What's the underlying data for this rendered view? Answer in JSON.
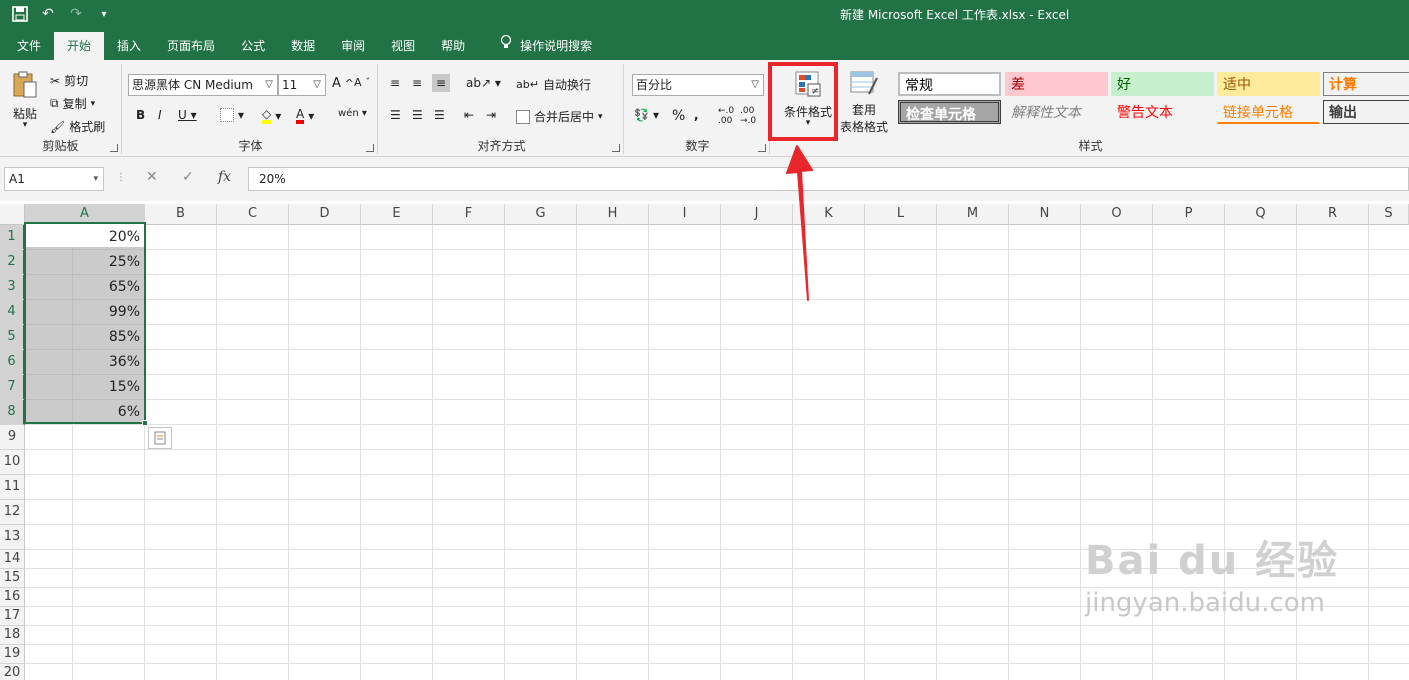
{
  "titlebar": {
    "title": "新建 Microsoft Excel 工作表.xlsx  -  Excel"
  },
  "tabs": [
    "文件",
    "开始",
    "插入",
    "页面布局",
    "公式",
    "数据",
    "审阅",
    "视图",
    "帮助"
  ],
  "tell_me": "操作说明搜索",
  "clipboard": {
    "paste": "粘贴",
    "cut": "剪切",
    "copy": "复制",
    "format_painter": "格式刷",
    "label": "剪贴板"
  },
  "font": {
    "name": "思源黑体 CN Medium",
    "size": "11",
    "label": "字体"
  },
  "alignment": {
    "wrap": "自动换行",
    "merge": "合并后居中",
    "label": "对齐方式"
  },
  "number": {
    "format": "百分比",
    "label": "数字"
  },
  "styles": {
    "conditional": "条件格式",
    "table_line1": "套用",
    "table_line2": "表格格式",
    "label": "样式",
    "cells": [
      {
        "text": "常规",
        "bg": "#ffffff",
        "color": "#000000"
      },
      {
        "text": "差",
        "bg": "#ffc7ce",
        "color": "#9c0006"
      },
      {
        "text": "好",
        "bg": "#c6efce",
        "color": "#006100"
      },
      {
        "text": "适中",
        "bg": "#ffeb9c",
        "color": "#9c5700"
      },
      {
        "text": "计算",
        "bg": "#f2f2f2",
        "color": "#fa7d00"
      },
      {
        "text": "检查单元格",
        "bg": "#a5a5a5",
        "color": "#ffffff"
      },
      {
        "text": "解释性文本",
        "bg": "transparent",
        "color": "#7f7f7f"
      },
      {
        "text": "警告文本",
        "bg": "transparent",
        "color": "#ff0000"
      },
      {
        "text": "链接单元格",
        "bg": "transparent",
        "color": "#fa7d00"
      },
      {
        "text": "输出",
        "bg": "#f2f2f2",
        "color": "#3f3f3f"
      }
    ]
  },
  "formula_bar": {
    "name_box": "A1",
    "value": "20%"
  },
  "columns": [
    "A",
    "B",
    "C",
    "D",
    "E",
    "F",
    "G",
    "H",
    "I",
    "J",
    "K",
    "L",
    "M",
    "N",
    "O",
    "P",
    "Q",
    "R",
    "S"
  ],
  "rows": [
    "1",
    "2",
    "3",
    "4",
    "5",
    "6",
    "7",
    "8",
    "9",
    "10",
    "11",
    "12",
    "13",
    "14",
    "15",
    "16",
    "17",
    "18",
    "19",
    "20"
  ],
  "cells_a": [
    "20%",
    "25%",
    "65%",
    "99%",
    "85%",
    "36%",
    "15%",
    "6%"
  ],
  "watermark": {
    "brand": "Bai du 经验",
    "url": "jingyan.baidu.com"
  },
  "colors": {
    "accent": "#217346",
    "highlight": "#e8262b"
  }
}
